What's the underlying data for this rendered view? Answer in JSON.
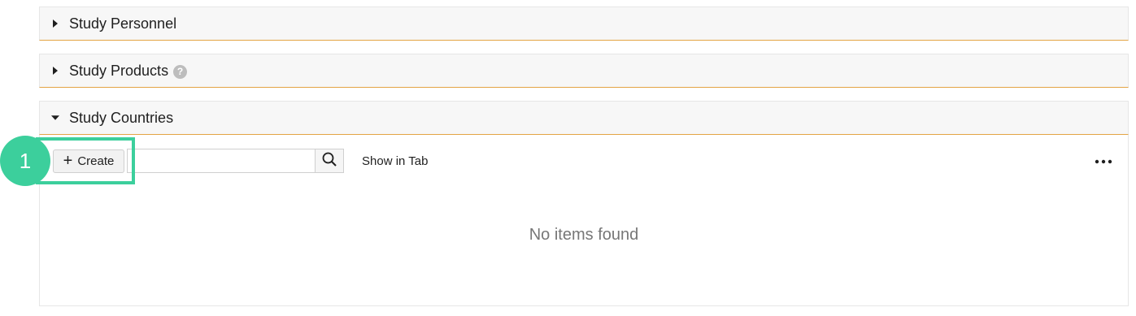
{
  "sections": [
    {
      "title": "Study Personnel",
      "expanded": false
    },
    {
      "title": "Study Products",
      "expanded": false,
      "help": "?"
    },
    {
      "title": "Study Countries",
      "expanded": true
    }
  ],
  "toolbar": {
    "create_label": "Create",
    "create_icon": "+",
    "search_placeholder": "",
    "search_value": "",
    "show_in_tab_label": "Show in Tab",
    "more_icon": "•••"
  },
  "list": {
    "empty_message": "No items found"
  },
  "annotation": {
    "step_number": "1",
    "color": "#3ccf9c"
  },
  "colors": {
    "section_underline": "#e3a445",
    "section_bg": "#f7f7f7"
  }
}
